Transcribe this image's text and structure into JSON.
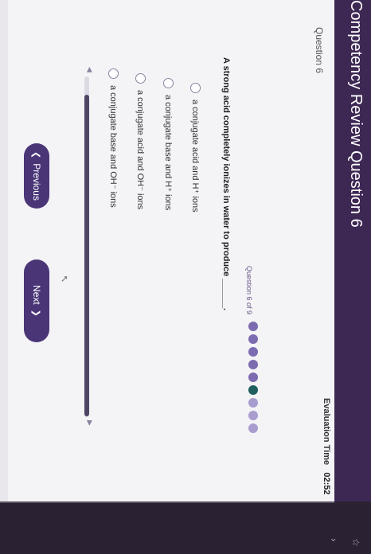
{
  "header": {
    "title": "Competency Review Question 6"
  },
  "question": {
    "label": "Question 6",
    "progress_text": "Question 6 of 9",
    "text": "A strong acid completely ionizes in water to produce ______.",
    "options": [
      {
        "text": "a conjugate acid and H⁺ ions"
      },
      {
        "text": "a conjugate base and H⁺ ions"
      },
      {
        "text": "a conjugate acid and OH⁻ ions"
      },
      {
        "text": "a conjugate base and OH⁻ ions"
      }
    ],
    "total": 9,
    "current": 6
  },
  "evaluation": {
    "label": "Evaluation Time",
    "value": "02:52"
  },
  "buttons": {
    "previous": "Previous",
    "next": "Next"
  },
  "scrollbar": {
    "position_fraction": 0.94
  },
  "icons": {
    "previous_chevron": "chevron-left-icon",
    "next_chevron": "chevron-right-icon",
    "scroll_left": "scroll-left-arrow-icon",
    "scroll_right": "scroll-right-arrow-icon",
    "cursor": "mouse-cursor-icon"
  },
  "colors": {
    "header_bg": "#3d2854",
    "button_bg": "#4a3577",
    "scroll_thumb": "#4e4565",
    "dot_done": "#7c6bb0",
    "dot_current": "#215e60",
    "dot_todo": "#a99dd0"
  }
}
